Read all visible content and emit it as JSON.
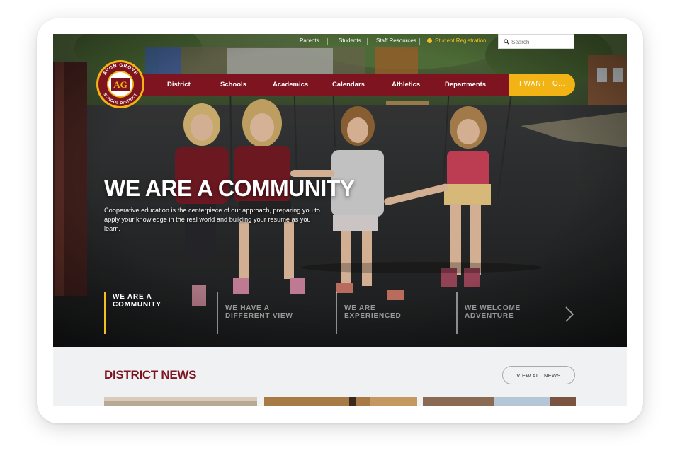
{
  "utility_nav": {
    "parents": "Parents",
    "students": "Students",
    "staff_resources": "Staff Resources",
    "student_registration": "Student Registration",
    "search_placeholder": "Search"
  },
  "logo": {
    "initials": "AG",
    "ring_text_top": "AVON GROVE",
    "ring_text_bottom": "SCHOOL DISTRICT"
  },
  "main_nav": {
    "items": [
      {
        "label": "District"
      },
      {
        "label": "Schools"
      },
      {
        "label": "Academics"
      },
      {
        "label": "Calendars"
      },
      {
        "label": "Athletics"
      },
      {
        "label": "Departments"
      }
    ],
    "i_want_to": "I WANT TO..."
  },
  "hero": {
    "headline": "WE ARE A COMMUNITY",
    "subtext": "Cooperative education is the centerpiece of our approach, preparing you to apply your knowledge in the real world and building your resume as you learn.",
    "slides": [
      {
        "line1": "WE ARE A",
        "line2": "COMMUNITY",
        "active": true
      },
      {
        "line1": "WE HAVE A",
        "line2": "DIFFERENT VIEW",
        "active": false
      },
      {
        "line1": "WE ARE",
        "line2": "EXPERIENCED",
        "active": false
      },
      {
        "line1": "WE WELCOME",
        "line2": "ADVENTURE",
        "active": false
      }
    ]
  },
  "news": {
    "title": "DISTRICT NEWS",
    "view_all": "VIEW ALL NEWS"
  },
  "colors": {
    "brand_maroon": "#7d1420",
    "brand_gold": "#f2b414",
    "accent_yellow": "#f2c020"
  }
}
